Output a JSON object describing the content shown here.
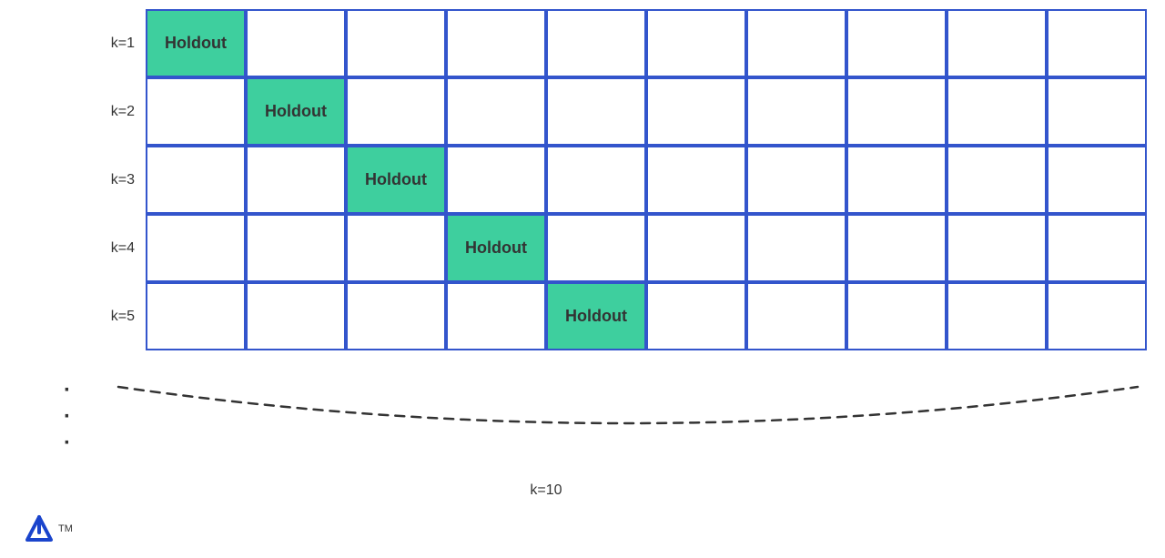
{
  "rows": [
    {
      "label": "k=1",
      "holdout_index": 0
    },
    {
      "label": "k=2",
      "holdout_index": 1
    },
    {
      "label": "k=3",
      "holdout_index": 2
    },
    {
      "label": "k=4",
      "holdout_index": 3
    },
    {
      "label": "k=5",
      "holdout_index": 4
    }
  ],
  "num_cells": 10,
  "holdout_text": "Holdout",
  "k10_label": "k=10",
  "dots": "⋮",
  "colors": {
    "holdout_bg": "#3ecf9e",
    "cell_border": "#3355cc",
    "dashed_line": "#333"
  }
}
